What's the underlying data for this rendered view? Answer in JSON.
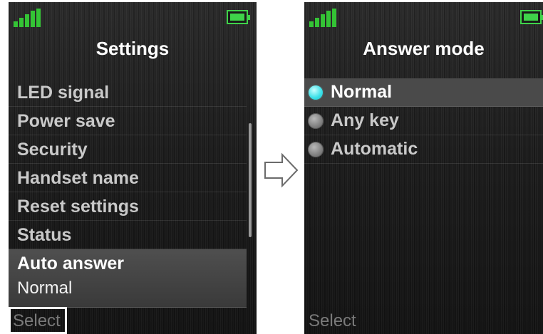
{
  "left_screen": {
    "title": "Settings",
    "menu_items": [
      {
        "label": "LED signal"
      },
      {
        "label": "Power save"
      },
      {
        "label": "Security"
      },
      {
        "label": "Handset name"
      },
      {
        "label": "Reset settings"
      },
      {
        "label": "Status"
      }
    ],
    "selected_item": {
      "label": "Auto answer",
      "value": "Normal"
    },
    "softkey_left": "Select"
  },
  "right_screen": {
    "title": "Answer mode",
    "options": [
      {
        "label": "Normal",
        "checked": true
      },
      {
        "label": "Any key",
        "checked": false
      },
      {
        "label": "Automatic",
        "checked": false
      }
    ],
    "softkey_left": "Select"
  },
  "icons": {
    "signal": "signal-strength-icon",
    "battery": "battery-icon",
    "transition": "right-arrow-icon"
  },
  "colors": {
    "signal": "#34c435",
    "battery": "#3fd34a",
    "radio_checked": "#38e0e8",
    "highlight": "#4a4a4a"
  }
}
